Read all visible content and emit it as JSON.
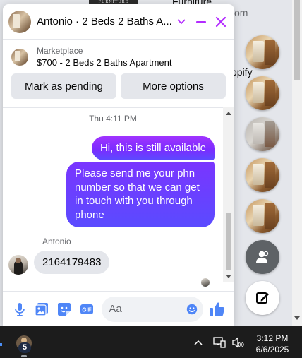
{
  "background": {
    "banner_text": "FURNITURE",
    "top_text": "Furniture",
    "fragments": [
      "om",
      "opify"
    ]
  },
  "chat": {
    "title": "Antonio · 2 Beds 2 Baths A...",
    "marketplace": {
      "label": "Marketplace",
      "listing": "$700 - 2 Beds 2 Baths Apartment",
      "pending_button": "Mark as pending",
      "options_button": "More options"
    },
    "messages": {
      "timestamp": "Thu 4:11 PM",
      "outgoing": [
        "Hi, this is still available",
        "Please send me your phn number so that we can get in touch with you through phone"
      ],
      "sender_name": "Antonio",
      "incoming": "2164179483"
    },
    "composer": {
      "placeholder": "Aa",
      "value": ""
    }
  },
  "right_rail": {
    "chat_heads": 5
  },
  "taskbar": {
    "badge_count": "5",
    "time": "3:12 PM",
    "date": "6/6/2025"
  },
  "colors": {
    "accent": "#a033ff",
    "close": "#b32cff",
    "like": "#4f86f7"
  }
}
